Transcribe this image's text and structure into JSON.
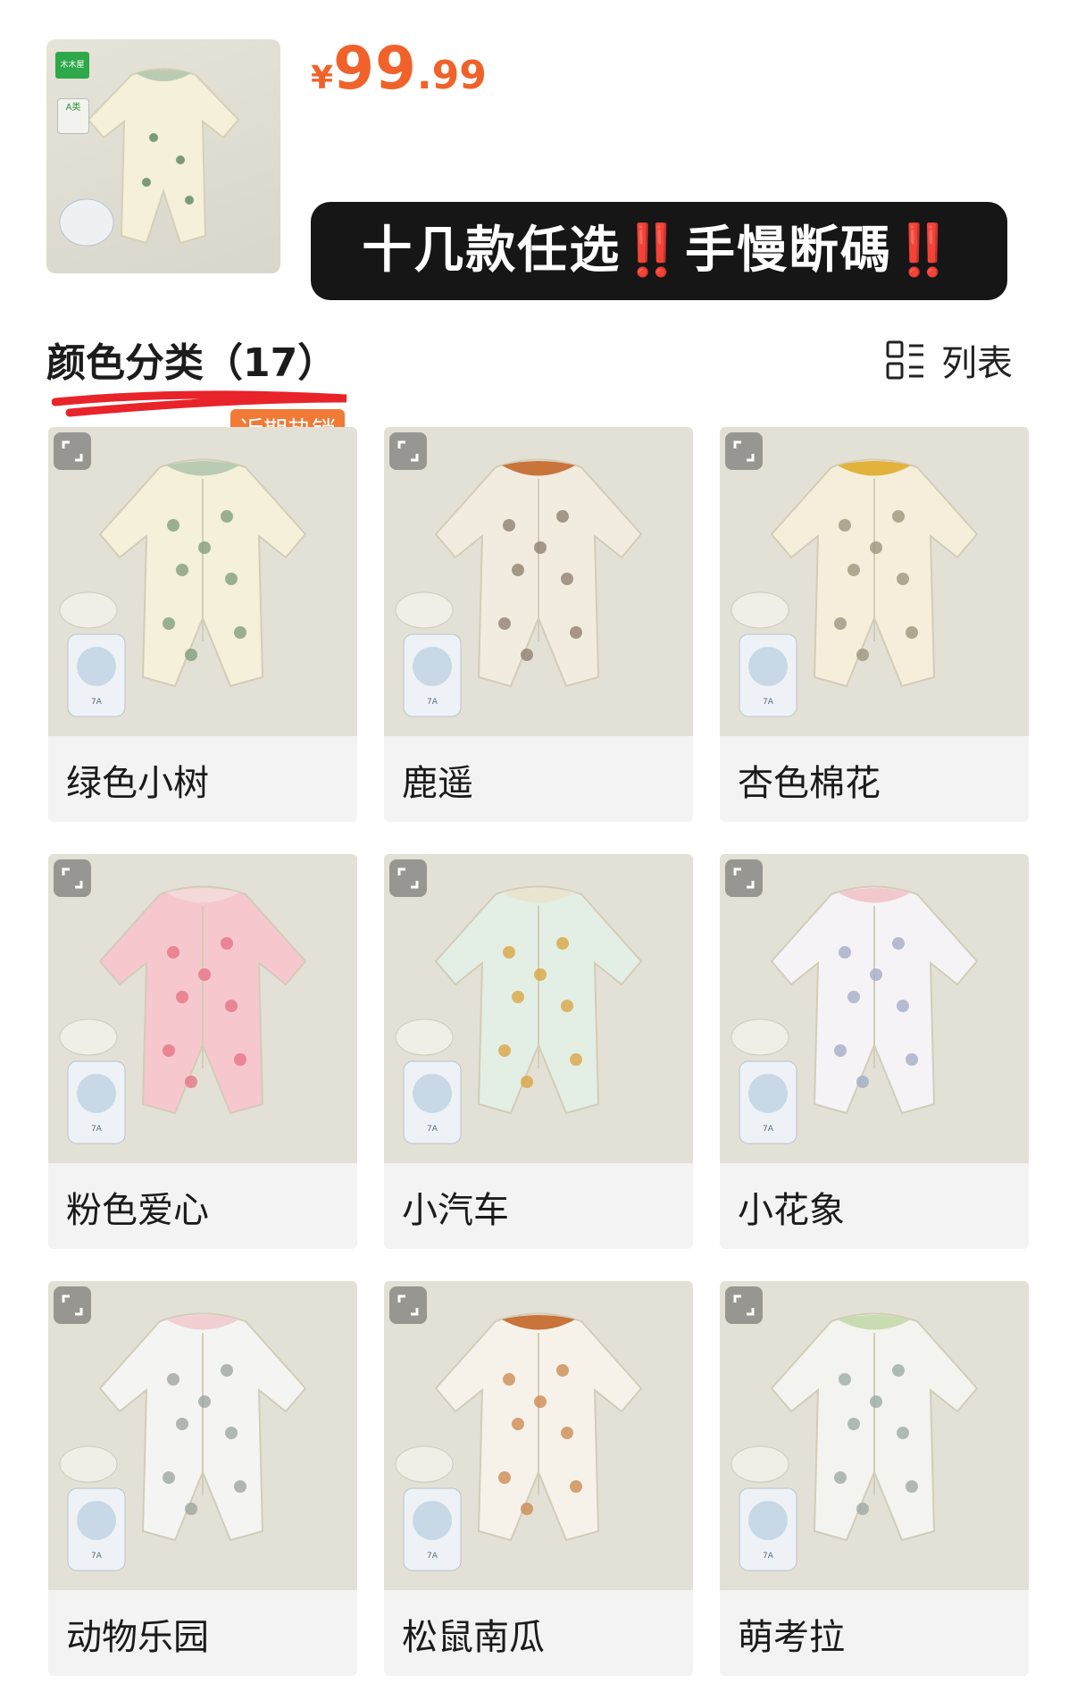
{
  "product": {
    "currency_symbol": "¥",
    "price_int": "99",
    "price_dec": ".99",
    "brand_badge": "木木屋",
    "grade_badge": "A类"
  },
  "promo": {
    "text_1": "十几款任选",
    "bang_1": "‼️",
    "text_2": "手慢断碼",
    "bang_2": "‼️"
  },
  "section": {
    "title": "颜色分类（17）",
    "hot_tag": "近期热销",
    "view_label": "列表",
    "view_icon": "list-grid-icon"
  },
  "colors": {
    "price": "#f0622a",
    "promo_bg": "#161616",
    "hot_tag": "#f07a36",
    "underline": "#e8242a"
  },
  "variants": [
    {
      "label": "绿色小树",
      "collar": "#b9cbb3",
      "body": "#f4f0d9",
      "print": "#7c9a78"
    },
    {
      "label": "鹿遥",
      "collar": "#c8743a",
      "body": "#f2ece0",
      "print": "#8b7b6a"
    },
    {
      "label": "杏色棉花",
      "collar": "#e2b23a",
      "body": "#f4eedb",
      "print": "#9a8f78"
    },
    {
      "label": "粉色爱心",
      "collar": "#f3d9da",
      "body": "#f6c7cc",
      "print": "#e46f82"
    },
    {
      "label": "小汽车",
      "collar": "#e8e4cf",
      "body": "#e3efe4",
      "print": "#d8a13b"
    },
    {
      "label": "小花象",
      "collar": "#f1c9cd",
      "body": "#f5f3f5",
      "print": "#a0a8c4"
    },
    {
      "label": "动物乐园",
      "collar": "#f1cfd2",
      "body": "#f4f4f2",
      "print": "#9aa19a"
    },
    {
      "label": "松鼠南瓜",
      "collar": "#c8743a",
      "body": "#f6f2ea",
      "print": "#c9864a"
    },
    {
      "label": "萌考拉",
      "collar": "#c9dbb0",
      "body": "#f3f3ef",
      "print": "#9aa7a0"
    }
  ]
}
